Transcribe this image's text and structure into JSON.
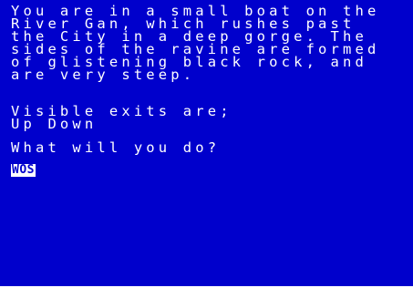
{
  "description_lines": [
    "You are in a small boat on the",
    "River Gan, which rushes past",
    "the City in a deep gorge. The",
    "sides of the ravine are formed",
    "of glistening black rock, and",
    "are very steep."
  ],
  "exits": {
    "heading": "Visible exits are;",
    "list": "Up Down"
  },
  "prompt": "What will you do?",
  "input": {
    "value": "WOS"
  },
  "colors": {
    "background": "#0000cc",
    "text": "#ffffff",
    "input_background": "#ffffff",
    "input_text": "#0000cc"
  }
}
